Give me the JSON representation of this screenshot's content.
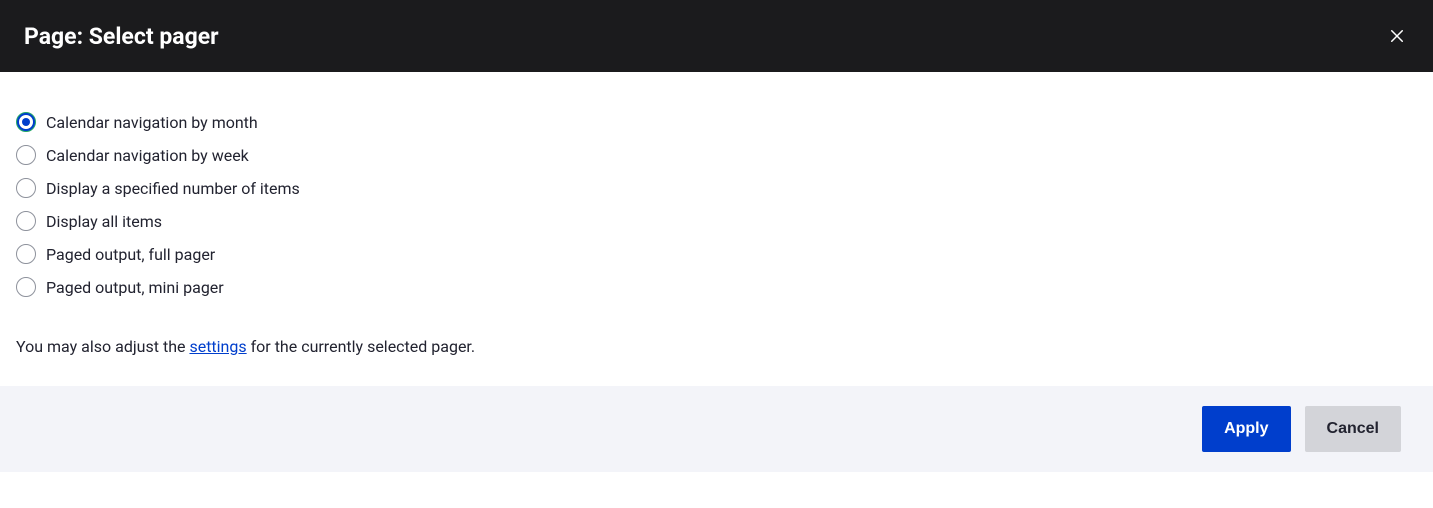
{
  "header": {
    "title": "Page: Select pager"
  },
  "options": [
    {
      "label": "Calendar navigation by month",
      "selected": true
    },
    {
      "label": "Calendar navigation by week",
      "selected": false
    },
    {
      "label": "Display a specified number of items",
      "selected": false
    },
    {
      "label": "Display all items",
      "selected": false
    },
    {
      "label": "Paged output, full pager",
      "selected": false
    },
    {
      "label": "Paged output, mini pager",
      "selected": false
    }
  ],
  "hint": {
    "prefix": "You may also adjust the ",
    "link": "settings",
    "suffix": " for the currently selected pager."
  },
  "buttons": {
    "apply": "Apply",
    "cancel": "Cancel"
  }
}
